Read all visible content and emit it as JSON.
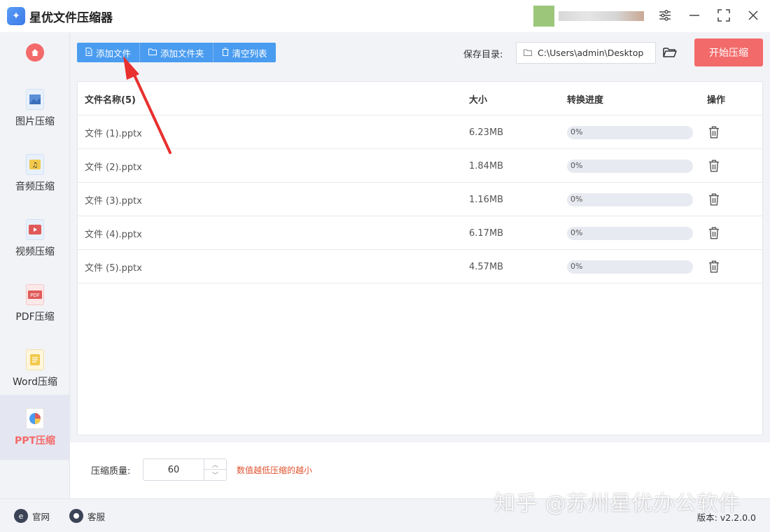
{
  "app": {
    "title": "星优文件压缩器",
    "logo_icon": "broom-icon"
  },
  "window_controls": [
    "settings-icon",
    "minimize-icon",
    "maximize-icon",
    "close-icon"
  ],
  "sidebar": {
    "home_icon": "home-icon",
    "items": [
      {
        "label": "图片压缩",
        "icon": "image-icon",
        "active": false
      },
      {
        "label": "音频压缩",
        "icon": "music-icon",
        "active": false
      },
      {
        "label": "视频压缩",
        "icon": "video-icon",
        "active": false
      },
      {
        "label": "PDF压缩",
        "icon": "pdf-icon",
        "active": false
      },
      {
        "label": "Word压缩",
        "icon": "word-icon",
        "active": false
      },
      {
        "label": "PPT压缩",
        "icon": "ppt-icon",
        "active": true
      }
    ]
  },
  "toolbar": {
    "add_file": "添加文件",
    "add_folder": "添加文件夹",
    "clear_list": "清空列表"
  },
  "save": {
    "label": "保存目录:",
    "path": "C:\\Users\\admin\\Desktop"
  },
  "start_button": "开始压缩",
  "table": {
    "headers": {
      "name": "文件名称(5)",
      "size": "大小",
      "progress": "转换进度",
      "action": "操作"
    },
    "rows": [
      {
        "name": "文件 (1).pptx",
        "size": "6.23MB",
        "progress": "0%",
        "progress_value": 0
      },
      {
        "name": "文件 (2).pptx",
        "size": "1.84MB",
        "progress": "0%",
        "progress_value": 0
      },
      {
        "name": "文件 (3).pptx",
        "size": "1.16MB",
        "progress": "0%",
        "progress_value": 0
      },
      {
        "name": "文件 (4).pptx",
        "size": "6.17MB",
        "progress": "0%",
        "progress_value": 0
      },
      {
        "name": "文件 (5).pptx",
        "size": "4.57MB",
        "progress": "0%",
        "progress_value": 0
      }
    ]
  },
  "quality": {
    "label": "压缩质量:",
    "value": "60",
    "hint": "数值越低压缩的越小"
  },
  "footer": {
    "website": "官网",
    "support": "客服",
    "version": "版本: v2.2.0.0"
  },
  "watermark": "知乎 @苏州星优办公软件",
  "colors": {
    "accent": "#4a9cf0",
    "primary_red": "#f36a6a",
    "hint_red": "#e0522f"
  }
}
